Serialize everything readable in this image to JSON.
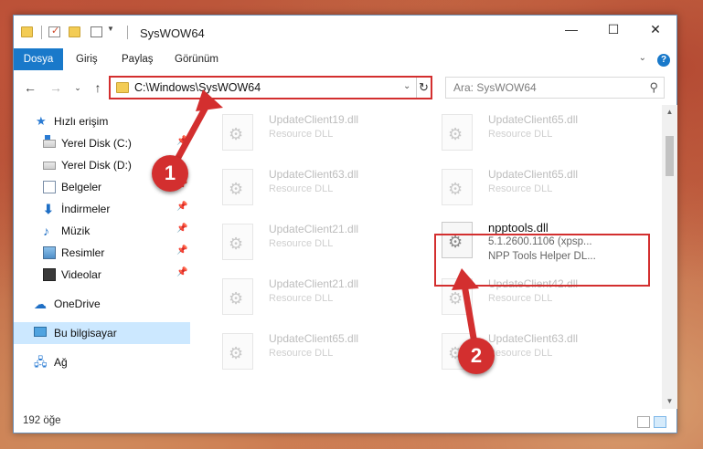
{
  "window": {
    "title": "SysWOW64"
  },
  "ribbon": {
    "tabs": [
      "Dosya",
      "Giriş",
      "Paylaş",
      "Görünüm"
    ]
  },
  "address": {
    "path": "C:\\Windows\\SysWOW64"
  },
  "search": {
    "placeholder": "Ara: SysWOW64"
  },
  "sidebar": {
    "quick_access": "Hızlı erişim",
    "items": [
      {
        "label": "Yerel Disk (C:)",
        "icon": "drive-icon"
      },
      {
        "label": "Yerel Disk (D:)",
        "icon": "drive-icon"
      },
      {
        "label": "Belgeler",
        "icon": "documents-icon"
      },
      {
        "label": "İndirmeler",
        "icon": "downloads-icon"
      },
      {
        "label": "Müzik",
        "icon": "music-icon"
      },
      {
        "label": "Resimler",
        "icon": "pictures-icon"
      },
      {
        "label": "Videolar",
        "icon": "videos-icon"
      }
    ],
    "onedrive": "OneDrive",
    "this_pc": "Bu bilgisayar",
    "network": "Ağ"
  },
  "files": [
    {
      "name": "UpdateClient19.dll",
      "desc": "Resource DLL"
    },
    {
      "name": "UpdateClient65.dll",
      "desc": "Resource DLL"
    },
    {
      "name": "UpdateClient63.dll",
      "desc": "Resource DLL"
    },
    {
      "name": "UpdateClient65.dll",
      "desc": "Resource DLL"
    },
    {
      "name": "UpdateClient21.dll",
      "desc": "Resource DLL"
    },
    {
      "name": "npptools.dll",
      "desc": "5.1.2600.1106 (xpsp...",
      "desc2": "NPP Tools Helper DL..."
    },
    {
      "name": "UpdateClient21.dll",
      "desc": "Resource DLL"
    },
    {
      "name": "UpdateClient42.dll",
      "desc": "Resource DLL"
    },
    {
      "name": "UpdateClient65.dll",
      "desc": "Resource DLL"
    },
    {
      "name": "UpdateClient63.dll",
      "desc": "Resource DLL"
    }
  ],
  "status": {
    "count": "192 öğe"
  },
  "annotations": {
    "step1": "1",
    "step2": "2"
  },
  "colors": {
    "accent": "#1979ca",
    "highlight": "#d32f2f"
  }
}
